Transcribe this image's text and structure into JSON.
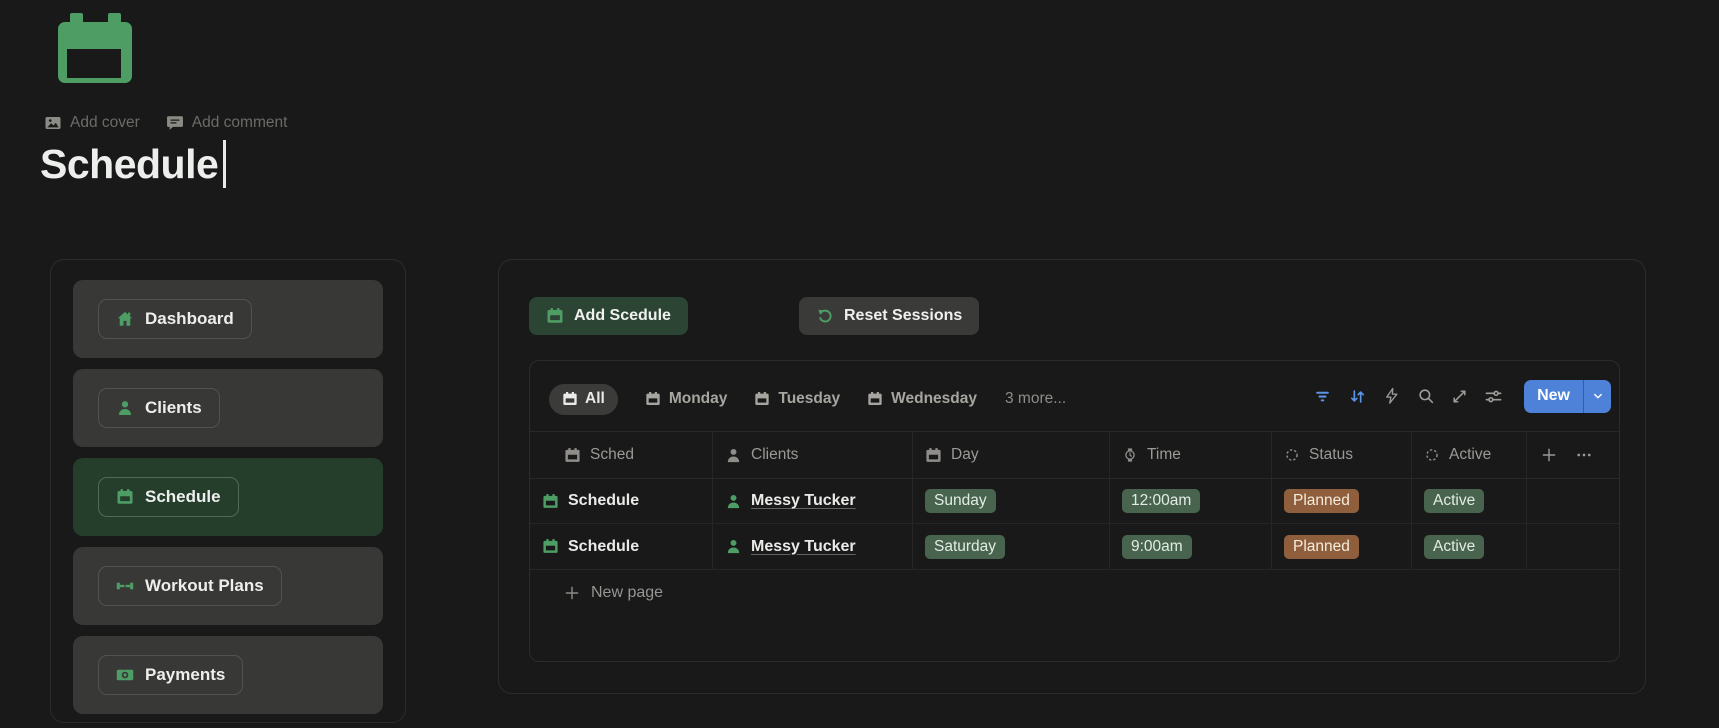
{
  "page": {
    "add_cover": "Add cover",
    "add_comment": "Add comment",
    "title": "Schedule"
  },
  "sidebar": {
    "items": [
      {
        "label": "Dashboard",
        "icon": "home-icon"
      },
      {
        "label": "Clients",
        "icon": "person-icon"
      },
      {
        "label": "Schedule",
        "icon": "calendar-icon",
        "active": true
      },
      {
        "label": "Workout Plans",
        "icon": "dumbbell-icon"
      },
      {
        "label": "Payments",
        "icon": "banknote-icon"
      }
    ]
  },
  "panel": {
    "add_schedule_label": "Add Scedule",
    "reset_sessions_label": "Reset Sessions"
  },
  "database": {
    "tabs": {
      "all": "All",
      "monday": "Monday",
      "tuesday": "Tuesday",
      "wednesday": "Wednesday",
      "more": "3 more..."
    },
    "toolbar": {
      "new_label": "New"
    },
    "columns": {
      "c0": "Sched",
      "c1": "Clients",
      "c2": "Day",
      "c3": "Time",
      "c4": "Status",
      "c5": "Active"
    },
    "rows": [
      {
        "sched": "Schedule",
        "client": "Messy Tucker",
        "day": "Sunday",
        "time": "12:00am",
        "status": "Planned",
        "active": "Active"
      },
      {
        "sched": "Schedule",
        "client": "Messy Tucker",
        "day": "Saturday",
        "time": "9:00am",
        "status": "Planned",
        "active": "Active"
      }
    ],
    "new_page_label": "New page"
  },
  "colors": {
    "accent_green": "#4d9d64",
    "active_item_green": "#253e2c",
    "item_card_gray": "#383836",
    "add_button_green": "#2b4433",
    "tag_green": "#48634e",
    "tag_orange": "#8f5f3d",
    "toolbar_blue": "#5d94e6",
    "new_button_blue": "#4d82d8"
  }
}
